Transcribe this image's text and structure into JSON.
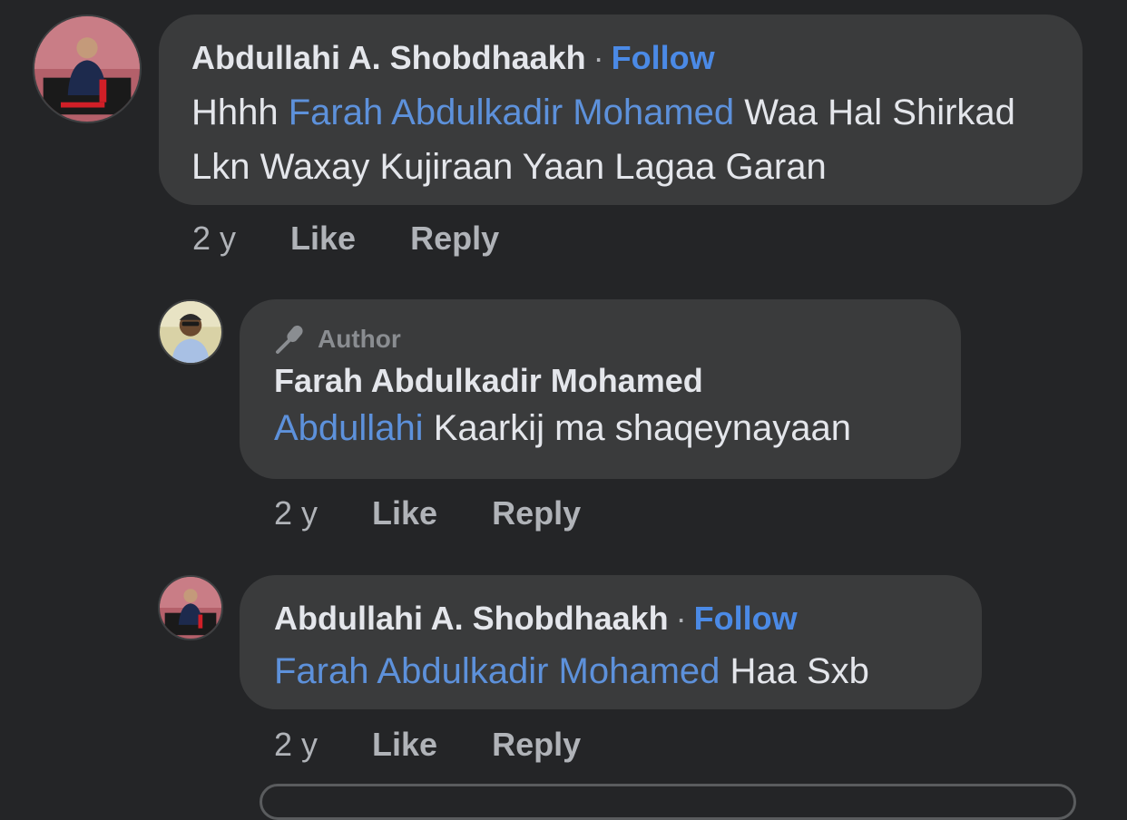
{
  "comments": [
    {
      "author": "Abdullahi A. Shobdhaakh",
      "separator": "·",
      "follow": "Follow",
      "mention": "Farah Abdulkadir Mohamed",
      "text": " Waa Hal Shirkad Lkn Waxay Kujiraan Yaan Lagaa Garan",
      "time": "2 y",
      "like": "Like",
      "reply": "Reply"
    },
    {
      "badge": "Author",
      "badge_icon": "microphone-icon",
      "author": "Farah Abdulkadir Mohamed",
      "mention": "Abdullahi",
      "text": " Kaarkij ma shaqeynayaan",
      "time": "2 y",
      "like": "Like",
      "reply": "Reply"
    },
    {
      "author": "Abdullahi A. Shobdhaakh",
      "separator": "·",
      "follow": "Follow",
      "mention": "Farah Abdulkadir Mohamed",
      "text": " Haa Sxb",
      "time": "2 y",
      "like": "Like",
      "reply": "Reply"
    }
  ],
  "colors": {
    "background": "#242527",
    "bubble": "#3a3b3c",
    "link": "#4b8ae6",
    "mention": "#5d91db",
    "secondary_text": "#b0b3b8"
  }
}
